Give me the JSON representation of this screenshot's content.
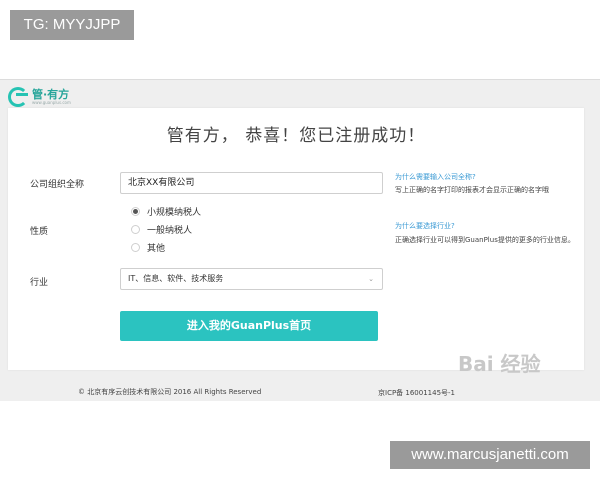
{
  "overlay": {
    "tag": "TG: MYYJJPP",
    "url": "www.marcusjanetti.com",
    "watermark": "Bai 经验"
  },
  "logo": {
    "text": "管·有方",
    "subtext": "www.guanplus.com"
  },
  "page": {
    "title": "管有方， 恭喜！您已注册成功！"
  },
  "form": {
    "company_label": "公司组织全称",
    "company_value": "北京XX有限公司",
    "nature_label": "性质",
    "nature_options": [
      {
        "label": "小规模纳税人",
        "checked": true
      },
      {
        "label": "一般纳税人",
        "checked": false
      },
      {
        "label": "其他",
        "checked": false
      }
    ],
    "industry_label": "行业",
    "industry_value": "IT、信息、软件、技术服务",
    "submit_label": "进入我的GuanPlus首页"
  },
  "help": {
    "q1": "为什么需要输入公司全称?",
    "a1": "写上正确的名字打印的报表才会显示正确的名字哦",
    "q2": "为什么要选择行业?",
    "a2": "正确选择行业可以得到GuanPlus提供的更多的行业信息。"
  },
  "footer": {
    "copyright": "© 北京有序云创技术有限公司 2016 All Rights Reserved",
    "icp": "京ICP备 16001145号-1"
  },
  "colors": {
    "accent": "#2bc3c0",
    "link": "#3a9ad4"
  }
}
